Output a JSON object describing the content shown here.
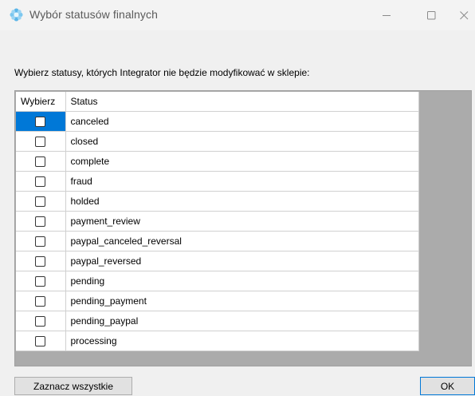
{
  "window": {
    "title": "Wybór statusów finalnych",
    "app_icon": "gear-flower-icon",
    "minimize_icon": "minimize-icon",
    "maximize_icon": "maximize-icon",
    "close_icon": "close-icon"
  },
  "instruction": "Wybierz statusy, których Integrator nie będzie modyfikować w sklepie:",
  "grid": {
    "columns": [
      "Wybierz",
      "Status"
    ],
    "rows": [
      {
        "status": "canceled",
        "checked": false,
        "selected": true
      },
      {
        "status": "closed",
        "checked": false
      },
      {
        "status": "complete",
        "checked": false
      },
      {
        "status": "fraud",
        "checked": false
      },
      {
        "status": "holded",
        "checked": false
      },
      {
        "status": "payment_review",
        "checked": false
      },
      {
        "status": "paypal_canceled_reversal",
        "checked": false
      },
      {
        "status": "paypal_reversed",
        "checked": false
      },
      {
        "status": "pending",
        "checked": false
      },
      {
        "status": "pending_payment",
        "checked": false
      },
      {
        "status": "pending_paypal",
        "checked": false
      },
      {
        "status": "processing",
        "checked": false
      }
    ]
  },
  "buttons": {
    "select_all": "Zaznacz wszystkie",
    "ok": "OK"
  },
  "colors": {
    "selection": "#0078d7",
    "grid_background": "#ababab"
  }
}
